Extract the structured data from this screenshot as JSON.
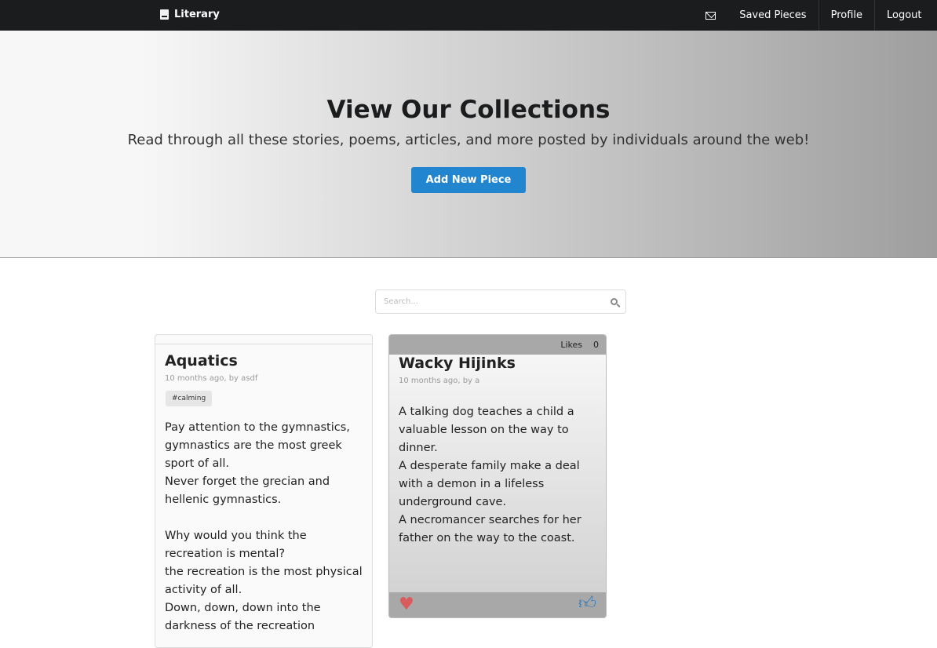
{
  "nav": {
    "brand": "Literary",
    "items": [
      "Saved Pieces",
      "Profile",
      "Logout"
    ]
  },
  "hero": {
    "title": "View Our Collections",
    "subtitle": "Read through all these stories, poems, articles, and more posted by individuals around the web!",
    "button": "Add New Piece"
  },
  "search": {
    "placeholder": "Search..."
  },
  "cards": [
    {
      "title": "Aquatics",
      "meta": "10 months ago, by asdf",
      "tag": "#calming",
      "body": "Pay attention to the gymnastics, gymnastics are the most greek sport of all.\nNever forget the grecian and hellenic gymnastics.\n\nWhy would you think the recreation is mental?\nthe recreation is the most physical activity of all.\nDown, down, down into the\ndarkness of the recreation"
    },
    {
      "title": "Wacky Hijinks",
      "meta": "10 months ago, by a",
      "likes_label": "Likes",
      "likes": "0",
      "body": "A talking dog teaches a child a valuable lesson on the way to dinner.\nA desperate family make a deal with a demon in a lifeless underground cave.\nA necromancer searches for her father on the way to the coast."
    }
  ]
}
